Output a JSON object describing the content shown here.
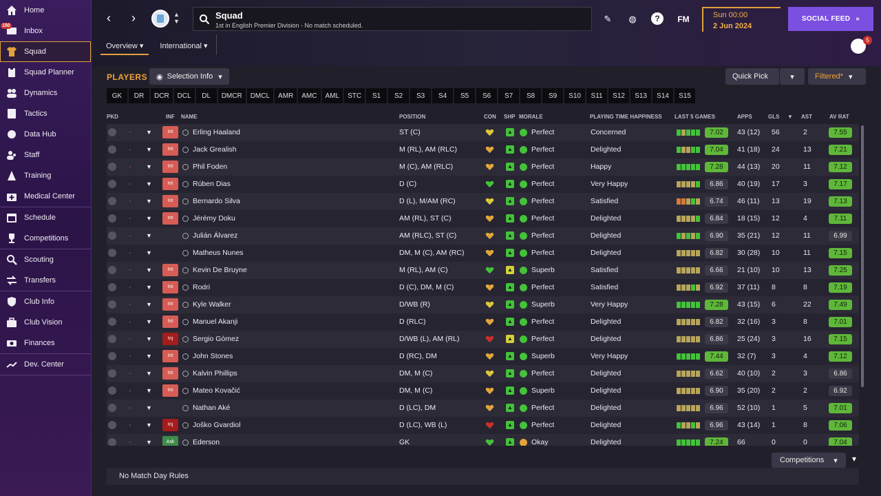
{
  "sidebar": {
    "groups": [
      [
        {
          "key": "home",
          "label": "Home",
          "icon": "home-icon"
        },
        {
          "key": "inbox",
          "label": "Inbox",
          "icon": "inbox-icon",
          "badge": "150"
        },
        {
          "key": "squad",
          "label": "Squad",
          "icon": "shirt-icon",
          "active": true
        },
        {
          "key": "squad-planner",
          "label": "Squad Planner",
          "icon": "clipboard-icon"
        },
        {
          "key": "dynamics",
          "label": "Dynamics",
          "icon": "people-icon"
        },
        {
          "key": "tactics",
          "label": "Tactics",
          "icon": "tactics-board-icon"
        },
        {
          "key": "data-hub",
          "label": "Data Hub",
          "icon": "data-hub-icon"
        },
        {
          "key": "staff",
          "label": "Staff",
          "icon": "staff-icon"
        },
        {
          "key": "training",
          "label": "Training",
          "icon": "training-cone-icon"
        },
        {
          "key": "medical",
          "label": "Medical Center",
          "icon": "medical-kit-icon"
        }
      ],
      [
        {
          "key": "schedule",
          "label": "Schedule",
          "icon": "calendar-icon"
        },
        {
          "key": "competitions",
          "label": "Competitions",
          "icon": "trophy-icon"
        }
      ],
      [
        {
          "key": "scouting",
          "label": "Scouting",
          "icon": "magnifier-icon"
        },
        {
          "key": "transfers",
          "label": "Transfers",
          "icon": "transfer-arrows-icon"
        }
      ],
      [
        {
          "key": "club-info",
          "label": "Club Info",
          "icon": "shield-icon"
        },
        {
          "key": "club-vision",
          "label": "Club Vision",
          "icon": "briefcase-icon"
        },
        {
          "key": "finances",
          "label": "Finances",
          "icon": "money-icon"
        }
      ],
      [
        {
          "key": "dev-center",
          "label": "Dev. Center",
          "icon": "dev-chart-icon"
        }
      ]
    ]
  },
  "header": {
    "title": "Squad",
    "subtitle": "1st in English Premier Division - No match scheduled.",
    "date_time": "Sun 00:00",
    "date_day": "2 Jun 2024",
    "social_feed": "SOCIAL FEED",
    "fm_logo": "FM",
    "notifications": "5",
    "tabs": [
      {
        "label": "Overview",
        "active": true
      },
      {
        "label": "International",
        "active": false
      }
    ]
  },
  "panel": {
    "title": "PLAYERS",
    "selection_info": "Selection Info",
    "quick_pick": "Quick Pick",
    "filtered": "Filtered*",
    "positions": [
      "GK",
      "DR",
      "DCR",
      "DCL",
      "DL",
      "DMCR",
      "DMCL",
      "AMR",
      "AMC",
      "AML",
      "STC",
      "S1",
      "S2",
      "S3",
      "S4",
      "S5",
      "S6",
      "S7",
      "S8",
      "S9",
      "S10",
      "S11",
      "S12",
      "S13",
      "S14",
      "S15"
    ],
    "columns": {
      "pkd": "PKD",
      "inf": "INF",
      "name": "NAME",
      "position": "POSITION",
      "con": "CON",
      "shp": "SHP",
      "morale": "MORALE",
      "pth": "PLAYING TIME HAPPINESS",
      "l5": "LAST 5 GAMES",
      "apps": "APPS",
      "gls": "GLS",
      "ast": "AST",
      "avr": "AV RAT"
    },
    "footer_text": "No Match Day Rules",
    "competitions_btn": "Competitions"
  },
  "colors": {
    "accent": "#e3a33a",
    "social": "#7b4fe0",
    "good": "#5fb73a",
    "bad": "#d65c55"
  },
  "players": [
    {
      "pkd": "-",
      "inf": "Int",
      "name": "Erling Haaland",
      "position": "ST (C)",
      "con": "yellow",
      "shp": "green",
      "morale": "Perfect",
      "pth": "Concerned",
      "l5": "gbggg",
      "l5r": "7.02",
      "l5g": true,
      "apps": "43 (12)",
      "gls": "56",
      "ast": "2",
      "avr": "7.55",
      "avg": true
    },
    {
      "pkd": "-",
      "inf": "Int",
      "name": "Jack Grealish",
      "position": "M (RL), AM (RLC)",
      "con": "orange",
      "shp": "green",
      "morale": "Perfect",
      "pth": "Delighted",
      "l5": "gbbgg",
      "l5r": "7.04",
      "l5g": true,
      "apps": "41 (18)",
      "gls": "24",
      "ast": "13",
      "avr": "7.21",
      "avg": true
    },
    {
      "pkd": "-",
      "inf": "Int",
      "name": "Phil Foden",
      "position": "M (C), AM (RLC)",
      "con": "orange",
      "shp": "green",
      "morale": "Perfect",
      "pth": "Happy",
      "l5": "ggggg",
      "l5r": "7.28",
      "l5g": true,
      "apps": "44 (13)",
      "gls": "20",
      "ast": "11",
      "avr": "7.12",
      "avg": true
    },
    {
      "pkd": "-",
      "inf": "Int",
      "name": "Rúben Dias",
      "position": "D (C)",
      "con": "green",
      "shp": "green",
      "morale": "Perfect",
      "pth": "Very Happy",
      "l5": "bbbbg",
      "l5r": "6.86",
      "l5g": false,
      "apps": "40 (19)",
      "gls": "17",
      "ast": "3",
      "avr": "7.17",
      "avg": true
    },
    {
      "pkd": "-",
      "inf": "Int",
      "name": "Bernardo Silva",
      "position": "D (L), M/AM (RC)",
      "con": "yellow",
      "shp": "green",
      "morale": "Perfect",
      "pth": "Satisfied",
      "l5": "oobgb",
      "l5r": "6.74",
      "l5g": false,
      "apps": "46 (11)",
      "gls": "13",
      "ast": "19",
      "avr": "7.13",
      "avg": true
    },
    {
      "pkd": "-",
      "inf": "Int",
      "name": "Jérémy Doku",
      "position": "AM (RL), ST (C)",
      "con": "orange",
      "shp": "green",
      "morale": "Perfect",
      "pth": "Delighted",
      "l5": "bbbbg",
      "l5r": "6.84",
      "l5g": false,
      "apps": "18 (15)",
      "gls": "12",
      "ast": "4",
      "avr": "7.11",
      "avg": true
    },
    {
      "pkd": "-",
      "inf": "",
      "name": "Julián Álvarez",
      "position": "AM (RLC), ST (C)",
      "con": "orange",
      "shp": "green",
      "morale": "Perfect",
      "pth": "Delighted",
      "l5": "gbgbg",
      "l5r": "6.90",
      "l5g": false,
      "apps": "35 (21)",
      "gls": "12",
      "ast": "11",
      "avr": "6.99",
      "avg": false
    },
    {
      "pkd": "-",
      "inf": "",
      "name": "Matheus Nunes",
      "position": "DM, M (C), AM (RC)",
      "con": "orange",
      "shp": "green",
      "morale": "Perfect",
      "pth": "Delighted",
      "l5": "bbbbb",
      "l5r": "6.82",
      "l5g": false,
      "apps": "30 (28)",
      "gls": "10",
      "ast": "11",
      "avr": "7.15",
      "avg": true
    },
    {
      "pkd": "-",
      "inf": "Int",
      "name": "Kevin De Bruyne",
      "position": "M (RL), AM (C)",
      "con": "green",
      "shp": "yellow",
      "morale": "Superb",
      "pth": "Satisfied",
      "l5": "bbbbb",
      "l5r": "6.66",
      "l5g": false,
      "apps": "21 (10)",
      "gls": "10",
      "ast": "13",
      "avr": "7.25",
      "avg": true
    },
    {
      "pkd": "-",
      "inf": "Int",
      "name": "Rodri",
      "position": "D (C), DM, M (C)",
      "con": "orange",
      "shp": "green",
      "morale": "Perfect",
      "pth": "Satisfied",
      "l5": "bbbgb",
      "l5r": "6.92",
      "l5g": false,
      "apps": "37 (11)",
      "gls": "8",
      "ast": "8",
      "avr": "7.19",
      "avg": true
    },
    {
      "pkd": "-",
      "inf": "Int",
      "name": "Kyle Walker",
      "position": "D/WB (R)",
      "con": "yellow",
      "shp": "green",
      "morale": "Superb",
      "pth": "Very Happy",
      "l5": "ggggg",
      "l5r": "7.28",
      "l5g": true,
      "apps": "43 (15)",
      "gls": "6",
      "ast": "22",
      "avr": "7.49",
      "avg": true
    },
    {
      "pkd": "-",
      "inf": "Int",
      "name": "Manuel Akanji",
      "position": "D (RLC)",
      "con": "orange",
      "shp": "green",
      "morale": "Perfect",
      "pth": "Delighted",
      "l5": "bbbbb",
      "l5r": "6.82",
      "l5g": false,
      "apps": "32 (16)",
      "gls": "3",
      "ast": "8",
      "avr": "7.01",
      "avg": true
    },
    {
      "pkd": "-",
      "inf": "Inj",
      "name": "Sergio Gómez",
      "position": "D/WB (L), AM (RL)",
      "con": "red",
      "shp": "yellow",
      "morale": "Perfect",
      "pth": "Delighted",
      "l5": "bbbbb",
      "l5r": "6.86",
      "l5g": false,
      "apps": "25 (24)",
      "gls": "3",
      "ast": "16",
      "avr": "7.15",
      "avg": true
    },
    {
      "pkd": "-",
      "inf": "Int",
      "name": "John Stones",
      "position": "D (RC), DM",
      "con": "orange",
      "shp": "green",
      "morale": "Superb",
      "pth": "Very Happy",
      "l5": "ggggg",
      "l5r": "7.44",
      "l5g": true,
      "apps": "32 (7)",
      "gls": "3",
      "ast": "4",
      "avr": "7.12",
      "avg": true
    },
    {
      "pkd": "-",
      "inf": "Int",
      "name": "Kalvin Phillips",
      "position": "DM, M (C)",
      "con": "yellow",
      "shp": "green",
      "morale": "Perfect",
      "pth": "Delighted",
      "l5": "bbbbb",
      "l5r": "6.62",
      "l5g": false,
      "apps": "40 (10)",
      "gls": "2",
      "ast": "3",
      "avr": "6.86",
      "avg": false
    },
    {
      "pkd": "-",
      "inf": "Int",
      "name": "Mateo Kovačić",
      "position": "DM, M (C)",
      "con": "orange",
      "shp": "green",
      "morale": "Superb",
      "pth": "Delighted",
      "l5": "bbbbb",
      "l5r": "6.90",
      "l5g": false,
      "apps": "35 (20)",
      "gls": "2",
      "ast": "2",
      "avr": "6.92",
      "avg": false
    },
    {
      "pkd": "-",
      "inf": "",
      "name": "Nathan Aké",
      "position": "D (LC), DM",
      "con": "orange",
      "shp": "green",
      "morale": "Perfect",
      "pth": "Delighted",
      "l5": "bbbbb",
      "l5r": "6.96",
      "l5g": false,
      "apps": "52 (10)",
      "gls": "1",
      "ast": "5",
      "avr": "7.01",
      "avg": true
    },
    {
      "pkd": "-",
      "inf": "Inj",
      "name": "Joško Gvardiol",
      "position": "D (LC), WB (L)",
      "con": "red",
      "shp": "green",
      "morale": "Perfect",
      "pth": "Delighted",
      "l5": "gbbgb",
      "l5r": "6.96",
      "l5g": false,
      "apps": "43 (14)",
      "gls": "1",
      "ast": "8",
      "avr": "7.06",
      "avg": true
    },
    {
      "pkd": "-",
      "inf": "Ask",
      "name": "Ederson",
      "position": "GK",
      "con": "green",
      "shp": "green",
      "morale": "Okay",
      "pth": "Delighted",
      "l5": "ggggg",
      "l5r": "7.24",
      "l5g": true,
      "apps": "66",
      "gls": "0",
      "ast": "0",
      "avr": "7.04",
      "avg": true
    }
  ]
}
